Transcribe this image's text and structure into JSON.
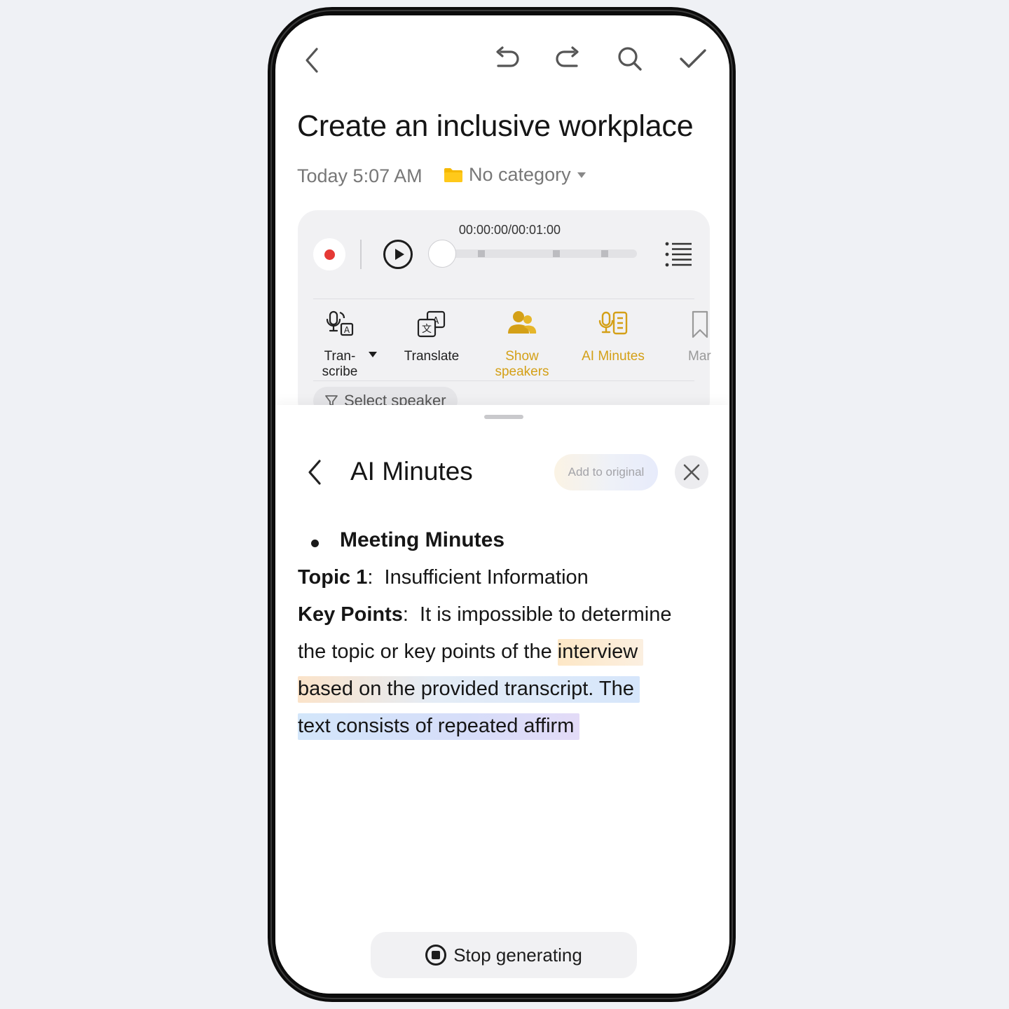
{
  "header": {
    "back_icon": "chevron-left-icon",
    "undo_icon": "undo-icon",
    "redo_icon": "redo-icon",
    "search_icon": "search-icon",
    "done_icon": "checkmark-icon"
  },
  "note": {
    "title": "Create an inclusive workplace",
    "date": "Today 5:07 AM",
    "category": "No category",
    "category_icon": "folder-icon"
  },
  "player": {
    "time_readout": "00:00:00/00:01:00",
    "progress": 0,
    "record_icon": "record-icon",
    "play_icon": "play-icon",
    "list_icon": "list-icon"
  },
  "toolbar": {
    "items": [
      {
        "label": "Tran-\nscribe",
        "icon": "transcribe-icon",
        "active": false
      },
      {
        "label": "Translate",
        "icon": "translate-icon",
        "active": false
      },
      {
        "label": "Show\nspeakers",
        "icon": "speakers-icon",
        "active": true
      },
      {
        "label": "AI Minutes",
        "icon": "ai-minutes-icon",
        "active": true
      },
      {
        "label": "Mar",
        "icon": "bookmark-icon",
        "active": false
      }
    ],
    "select_speaker": "Select speaker"
  },
  "sheet": {
    "title": "AI Minutes",
    "add_to_original": "Add to original",
    "heading": "Meeting Minutes",
    "topic_label": "Topic 1",
    "topic_value": "Insufficient Information",
    "keypoints_label": "Key Points",
    "lines": [
      "It is impossible to determine",
      "the topic or key points of the ",
      "interview",
      "based on the provided transcript. The",
      "text consists of repeated affirm"
    ],
    "stop_label": "Stop generating"
  },
  "colors": {
    "accent": "#d4a017",
    "record": "#e53935",
    "background": "#eff1f5"
  }
}
